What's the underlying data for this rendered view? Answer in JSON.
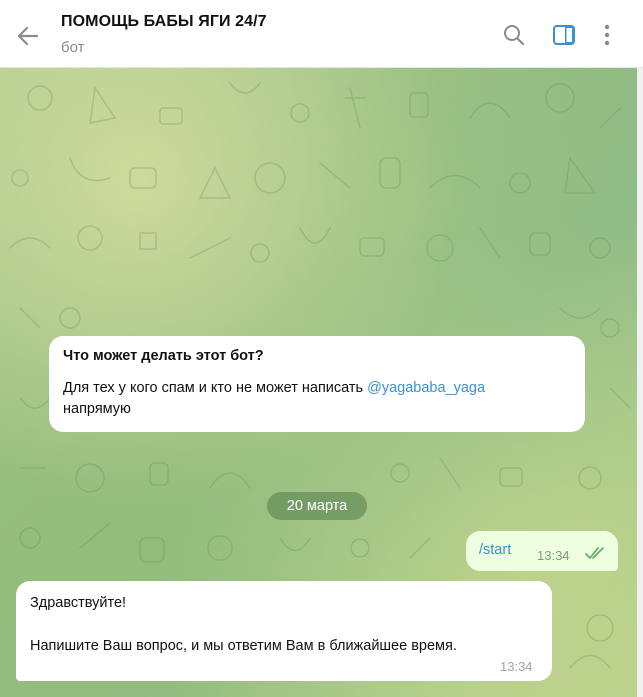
{
  "header": {
    "title": "ПОМОЩЬ БАБЫ ЯГИ 24/7",
    "subtitle": "бот",
    "icons": [
      "back-arrow-icon",
      "search-icon",
      "sidebar-toggle-icon",
      "more-vertical-icon"
    ],
    "accent": "#3a8fd6"
  },
  "info_card": {
    "title": "Что может делать этот бот?",
    "text_before": "Для тех у кого спам и кто не может написать ",
    "mention": "@yagababa_yaga",
    "text_after": "напрямую"
  },
  "date_separator": "20 марта",
  "messages": [
    {
      "direction": "out",
      "text": "/start",
      "time": "13:34",
      "status": "read"
    },
    {
      "direction": "in",
      "lines": [
        "Здравствуйте!",
        "Напишите Ваш вопрос, и мы ответим Вам в ближайшее время."
      ],
      "time": "13:34"
    }
  ]
}
